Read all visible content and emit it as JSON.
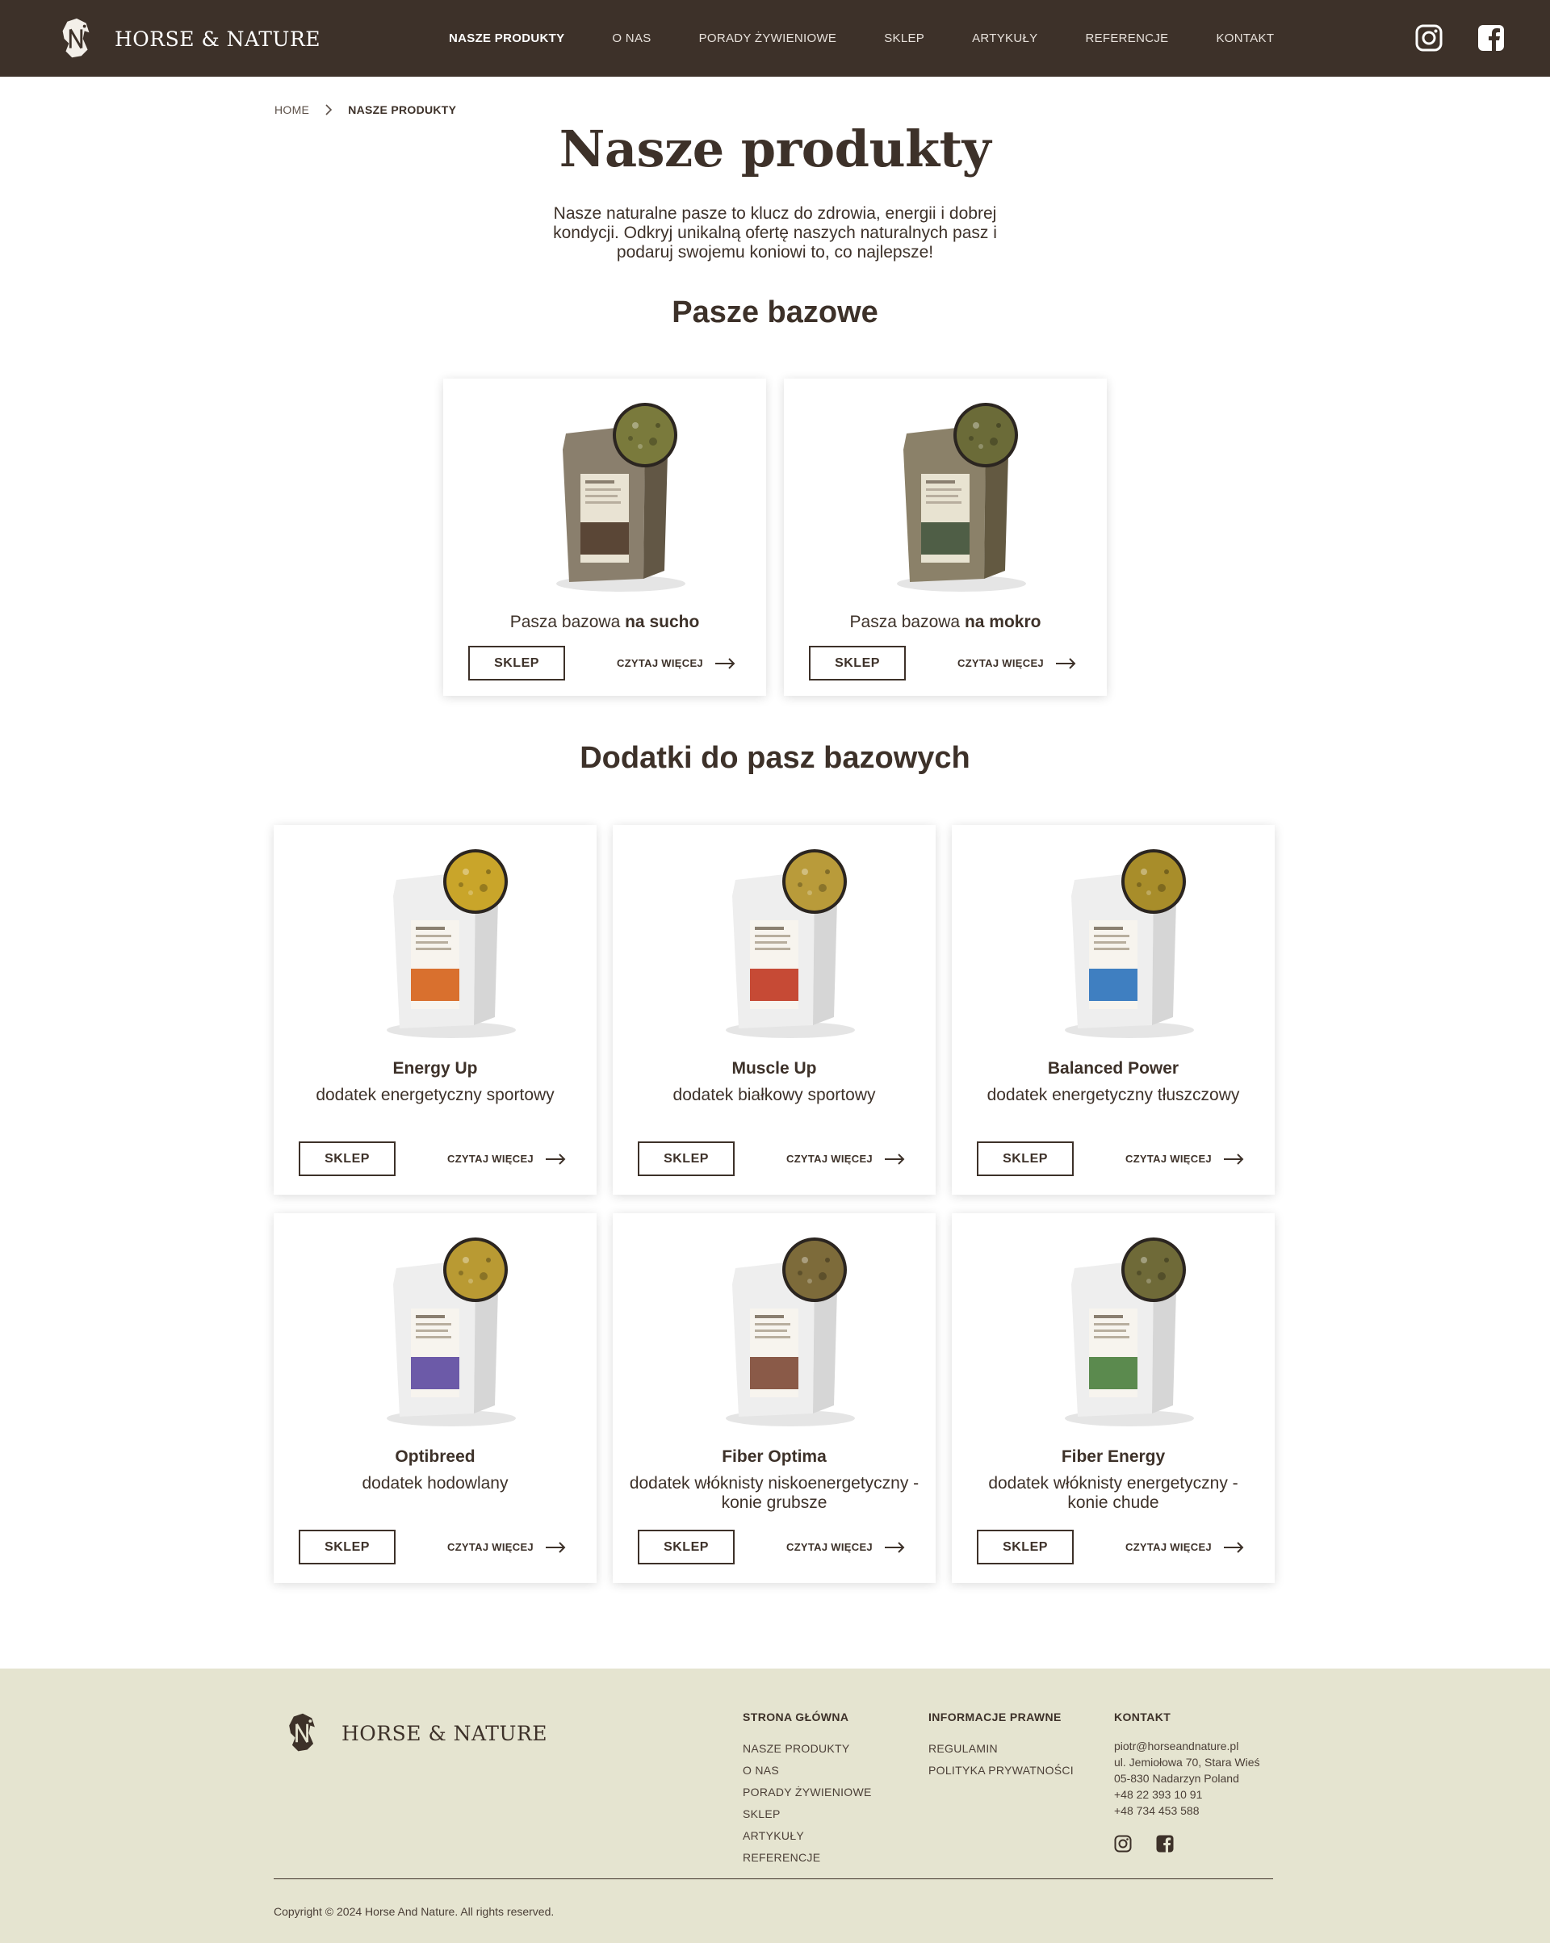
{
  "brand": {
    "name": "HORSE & NATURE"
  },
  "nav": {
    "items": [
      {
        "label": "NASZE PRODUKTY",
        "active": true
      },
      {
        "label": "O NAS"
      },
      {
        "label": "PORADY ŻYWIENIOWE"
      },
      {
        "label": "SKLEP"
      },
      {
        "label": "ARTYKUŁY"
      },
      {
        "label": "REFERENCJE"
      },
      {
        "label": "KONTAKT"
      }
    ],
    "social_icons": [
      "instagram-icon",
      "facebook-icon"
    ]
  },
  "breadcrumb": {
    "home": "HOME",
    "current": "NASZE PRODUKTY"
  },
  "hero": {
    "title": "Nasze produkty",
    "intro": "Nasze naturalne pasze to klucz do zdrowia, energii i dobrej kondycji. Odkryj unikalną ofertę naszych naturalnych pasz i podaruj swojemu koniowi to, co najlepsze!"
  },
  "sections": {
    "base": {
      "title": "Pasze bazowe",
      "products": [
        {
          "prefix": "Pasza bazowa ",
          "bold": "na sucho",
          "shop": "SKLEP",
          "more": "CZYTAJ WIĘCEJ",
          "bag": "#8a7f6d",
          "label": "#e9e3d3",
          "band": "#5a4636",
          "feed": "#7a7a3c"
        },
        {
          "prefix": "Pasza bazowa ",
          "bold": "na mokro",
          "shop": "SKLEP",
          "more": "CZYTAJ WIĘCEJ",
          "bag": "#8b8169",
          "label": "#e8e3d1",
          "band": "#4f5e46",
          "feed": "#6b6b38"
        }
      ]
    },
    "supplements": {
      "title": "Dodatki do pasz bazowych",
      "products": [
        {
          "name": "Energy Up",
          "desc": "dodatek energetyczny sportowy",
          "shop": "SKLEP",
          "more": "CZYTAJ WIĘCEJ",
          "accent": "#d9702e",
          "feed": "#c9a52a"
        },
        {
          "name": "Muscle Up",
          "desc": "dodatek białkowy sportowy",
          "shop": "SKLEP",
          "more": "CZYTAJ WIĘCEJ",
          "accent": "#c64a35",
          "feed": "#b99b3a"
        },
        {
          "name": "Balanced Power",
          "desc": "dodatek energetyczny tłuszczowy",
          "shop": "SKLEP",
          "more": "CZYTAJ WIĘCEJ",
          "accent": "#3f7fc1",
          "feed": "#a88d2a"
        },
        {
          "name": "Optibreed",
          "desc": "dodatek hodowlany",
          "shop": "SKLEP",
          "more": "CZYTAJ WIĘCEJ",
          "accent": "#6c5aa8",
          "feed": "#b99a33"
        },
        {
          "name": "Fiber Optima",
          "desc": "dodatek włóknisty niskoenergetyczny - konie grubsze",
          "shop": "SKLEP",
          "more": "CZYTAJ WIĘCEJ",
          "accent": "#8a5a48",
          "feed": "#7d6b3a"
        },
        {
          "name": "Fiber Energy",
          "desc": "dodatek włóknisty energetyczny - konie chude",
          "shop": "SKLEP",
          "more": "CZYTAJ WIĘCEJ",
          "accent": "#5b8a4e",
          "feed": "#6f6a38"
        }
      ]
    }
  },
  "footer": {
    "col1": {
      "title": "STRONA GŁÓWNA",
      "links": [
        "NASZE PRODUKTY",
        "O NAS",
        "PORADY ŻYWIENIOWE",
        "SKLEP",
        "ARTYKUŁY",
        "REFERENCJE"
      ]
    },
    "col2": {
      "title": "INFORMACJE PRAWNE",
      "links": [
        "REGULAMIN",
        "POLITYKA PRYWATNOŚCI"
      ]
    },
    "col3": {
      "title": "KONTAKT",
      "lines": [
        "piotr@horseandnature.pl",
        "ul. Jemiołowa 70, Stara Wieś",
        "05-830 Nadarzyn Poland",
        "+48 22 393 10 91",
        "+48 734 453 588"
      ]
    },
    "copyright": "Copyright © 2024 Horse And Nature. All rights reserved."
  },
  "colors": {
    "header_bg": "#3d3129",
    "text_primary": "#3d3129",
    "footer_bg": "#e5e4d0",
    "card_bg": "#ffffff"
  }
}
